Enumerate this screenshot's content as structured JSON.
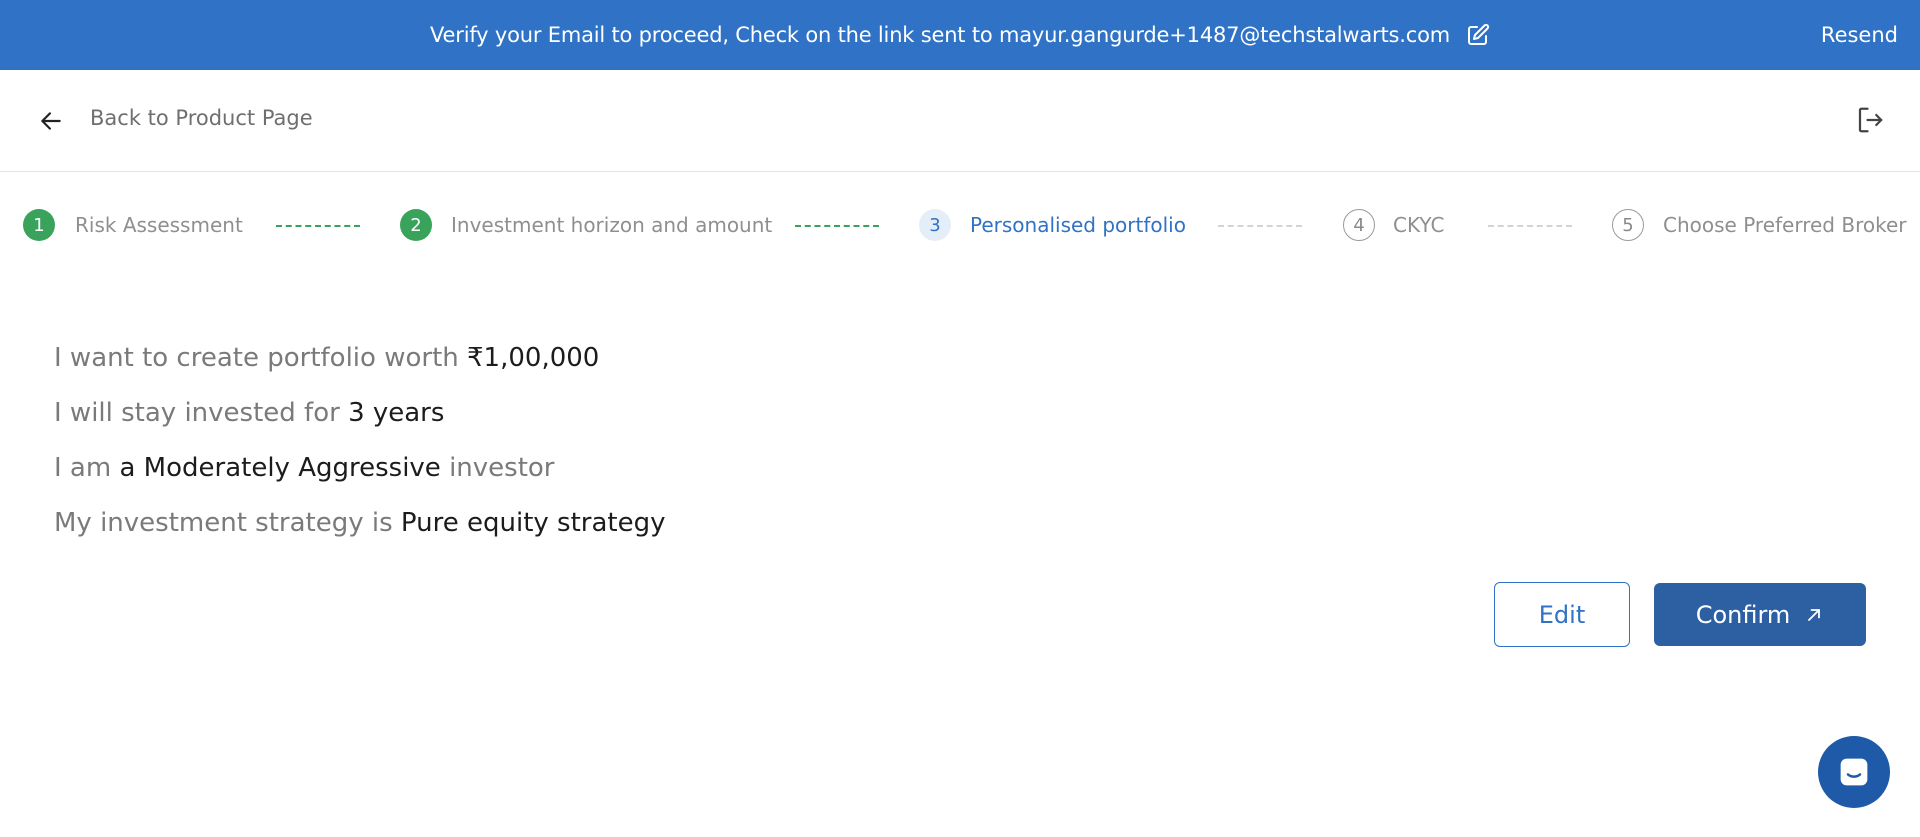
{
  "banner": {
    "message": "Verify your Email to proceed, Check on the link sent to mayur.gangurde+1487@techstalwarts.com",
    "edit_icon": "edit-icon",
    "resend_label": "Resend"
  },
  "nav": {
    "back_icon": "arrow-left-icon",
    "back_label": "Back to Product Page",
    "logout_icon": "logout-icon"
  },
  "stepper": {
    "steps": [
      {
        "number": "1",
        "label": "Risk Assessment",
        "state": "completed"
      },
      {
        "number": "2",
        "label": "Investment horizon and amount",
        "state": "completed"
      },
      {
        "number": "3",
        "label": "Personalised portfolio",
        "state": "active"
      },
      {
        "number": "4",
        "label": "CKYC",
        "state": "pending"
      },
      {
        "number": "5",
        "label": "Choose Preferred Broker",
        "state": "pending"
      }
    ]
  },
  "summary": {
    "line1_prefix": "I want to create portfolio worth ",
    "line1_value": "₹1,00,000",
    "line2_prefix": "I will stay invested for ",
    "line2_value": "3 years",
    "line3_prefix": "I am ",
    "line3_value": "a Moderately Aggressive",
    "line3_suffix": " investor",
    "line4_prefix": "My investment strategy is ",
    "line4_value": "Pure equity strategy"
  },
  "actions": {
    "edit_label": "Edit",
    "confirm_label": "Confirm",
    "confirm_icon": "arrow-up-right-icon"
  },
  "chat": {
    "icon": "chat-icon"
  },
  "colors": {
    "primary": "#2f72c6",
    "confirm_bg": "#2d5fa3",
    "success": "#3aa35b",
    "chat_bg": "#1e5aa8"
  }
}
